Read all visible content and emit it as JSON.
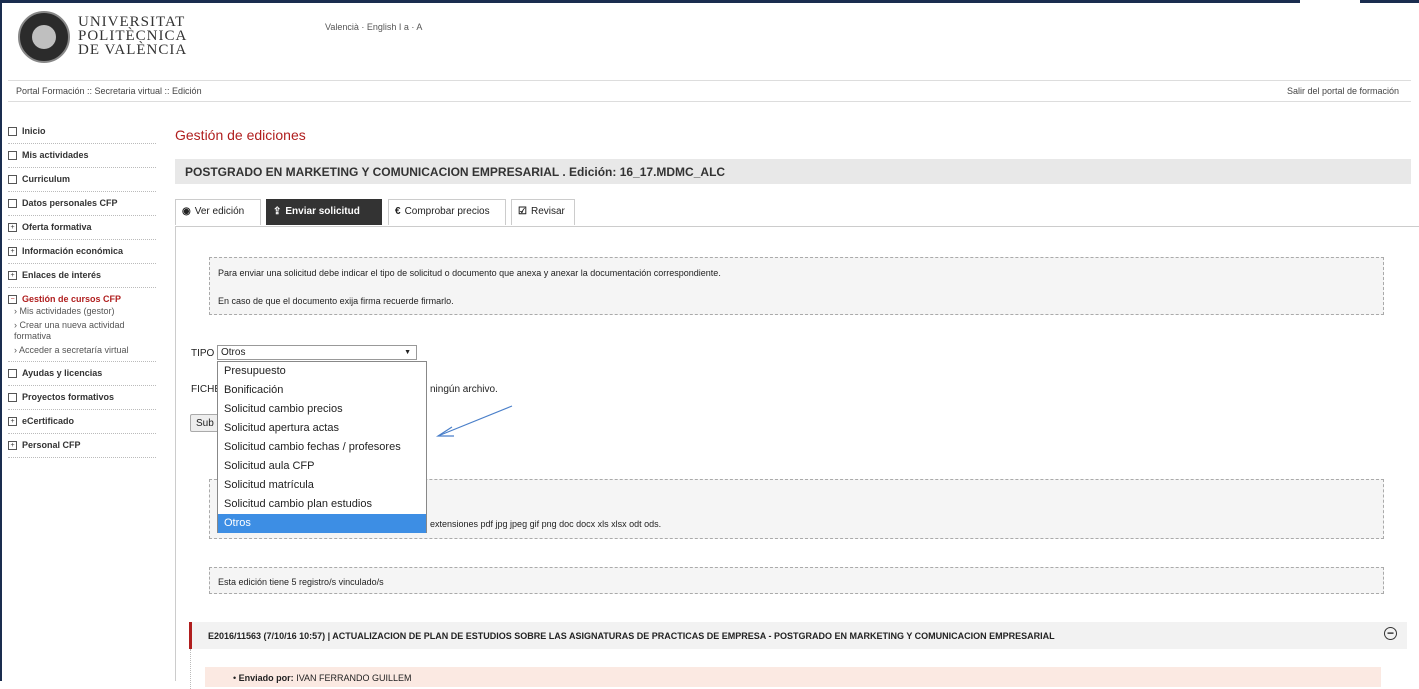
{
  "header": {
    "logo_text": "UNIVERSITAT\nPOLITÈCNICA\nDE VALÈNCIA",
    "languages": "Valencià · English  I  a · A"
  },
  "breadcrumb": {
    "path": "Portal Formación :: Secretaria virtual :: Edición",
    "exit_link": "Salir del portal de formación"
  },
  "sidebar": {
    "items_top": [
      {
        "label": "Inicio",
        "marker": ""
      },
      {
        "label": "Mis actividades",
        "marker": ""
      },
      {
        "label": "Curriculum",
        "marker": ""
      },
      {
        "label": "Datos personales CFP",
        "marker": ""
      },
      {
        "label": "Oferta formativa",
        "marker": "+"
      },
      {
        "label": "Información económica",
        "marker": "+"
      },
      {
        "label": "Enlaces de interés",
        "marker": "+"
      },
      {
        "label": "Gestión de cursos CFP",
        "marker": "−"
      }
    ],
    "subitems": [
      "Mis actividades (gestor)",
      "Crear una nueva actividad formativa",
      "Acceder a secretaría virtual"
    ],
    "items_bottom": [
      {
        "label": "Ayudas y licencias",
        "marker": ""
      },
      {
        "label": "Proyectos formativos",
        "marker": ""
      },
      {
        "label": "eCertificado",
        "marker": "+"
      },
      {
        "label": "Personal CFP",
        "marker": "+"
      }
    ]
  },
  "main": {
    "title": "Gestión de ediciones",
    "edition_bar": "POSTGRADO EN MARKETING Y COMUNICACION EMPRESARIAL . Edición: 16_17.MDMC_ALC",
    "tabs": [
      {
        "label": "Ver edición",
        "icon": "eye-icon"
      },
      {
        "label": "Enviar solicitud",
        "icon": "upload-icon"
      },
      {
        "label": "Comprobar precios",
        "icon": "euro-icon"
      },
      {
        "label": "Revisar",
        "icon": "check-square-icon"
      }
    ],
    "info_line1": "Para enviar una solicitud debe indicar el tipo de solicitud o documento que anexa y anexar la documentación correspondiente.",
    "info_line2": "En caso de que el documento exija firma recuerde firmarlo.",
    "tipo_label": "TIPO",
    "tipo_selected": "Otros",
    "tipo_options": [
      "Presupuesto",
      "Bonificación",
      "Solicitud cambio precios",
      "Solicitud apertura actas",
      "Solicitud cambio fechas / profesores",
      "Solicitud aula CFP",
      "Solicitud matrícula",
      "Solicitud cambio plan estudios",
      "Otros"
    ],
    "fichero_label": "FICHE",
    "no_file_text": "ningún archivo.",
    "submit_label": "Sub",
    "extensions_text": "extensiones pdf jpg jpeg gif png doc docx xls xlsx odt ods.",
    "linked_text": "Esta edición tiene 5 registro/s vinculado/s",
    "record_title": "E2016/11563 (7/10/16 10:57) | ACTUALIZACION DE PLAN DE ESTUDIOS SOBRE LAS ASIGNATURAS DE PRACTICAS DE EMPRESA - POSTGRADO EN MARKETING Y COMUNICACION EMPRESARIAL",
    "record_sender_label": "Enviado por:",
    "record_sender": "IVAN FERRANDO GUILLEM"
  },
  "colors": {
    "accent_red": "#b01e1e",
    "selected_blue": "#3d8ee4",
    "annotation_arrow": "#4a7fc9"
  }
}
